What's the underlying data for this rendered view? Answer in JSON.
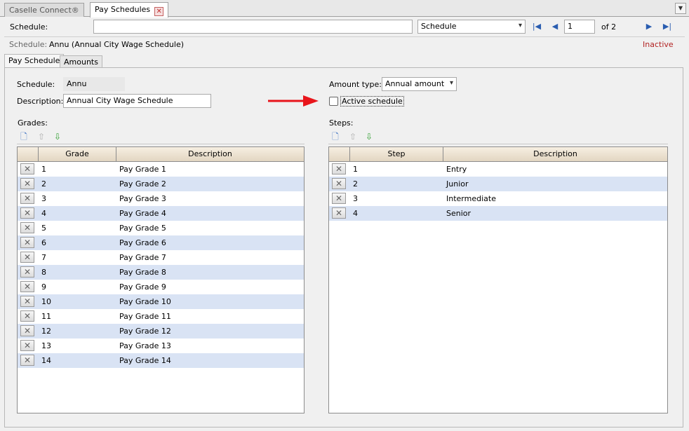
{
  "tabs": [
    {
      "label": "Caselle Connect®"
    },
    {
      "label": "Pay Schedules"
    }
  ],
  "nav": {
    "schedule_label": "Schedule:",
    "search_value": "",
    "type_value": "Schedule",
    "page_value": "1",
    "page_of": "of 2"
  },
  "record": {
    "label": "Schedule:",
    "value": "Annu (Annual City Wage Schedule)",
    "status": "Inactive"
  },
  "inner_tabs": [
    {
      "label": "Pay Schedule"
    },
    {
      "label": "Amounts"
    }
  ],
  "form": {
    "schedule_label": "Schedule:",
    "schedule_value": "Annu",
    "description_label": "Description:",
    "description_value": "Annual City Wage Schedule",
    "amount_type_label": "Amount type:",
    "amount_type_value": "Annual amount",
    "active_label": "Active schedule",
    "active_checked": false
  },
  "grades": {
    "title": "Grades:",
    "columns": [
      "Grade",
      "Description"
    ],
    "rows": [
      {
        "grade": "1",
        "desc": "Pay Grade 1"
      },
      {
        "grade": "2",
        "desc": "Pay Grade 2"
      },
      {
        "grade": "3",
        "desc": "Pay Grade 3"
      },
      {
        "grade": "4",
        "desc": "Pay Grade 4"
      },
      {
        "grade": "5",
        "desc": "Pay Grade 5"
      },
      {
        "grade": "6",
        "desc": "Pay Grade 6"
      },
      {
        "grade": "7",
        "desc": "Pay Grade 7"
      },
      {
        "grade": "8",
        "desc": "Pay Grade 8"
      },
      {
        "grade": "9",
        "desc": "Pay Grade 9"
      },
      {
        "grade": "10",
        "desc": "Pay Grade 10"
      },
      {
        "grade": "11",
        "desc": "Pay Grade 11"
      },
      {
        "grade": "12",
        "desc": "Pay Grade 12"
      },
      {
        "grade": "13",
        "desc": "Pay Grade 13"
      },
      {
        "grade": "14",
        "desc": "Pay Grade 14"
      }
    ]
  },
  "steps": {
    "title": "Steps:",
    "columns": [
      "Step",
      "Description"
    ],
    "rows": [
      {
        "step": "1",
        "desc": "Entry"
      },
      {
        "step": "2",
        "desc": "Junior"
      },
      {
        "step": "3",
        "desc": "Intermediate"
      },
      {
        "step": "4",
        "desc": "Senior"
      }
    ]
  },
  "colors": {
    "status_inactive": "#b22222",
    "row_alt": "#d9e3f4",
    "arrow": "#e8151b",
    "nav_icon": "#2a5db0"
  }
}
